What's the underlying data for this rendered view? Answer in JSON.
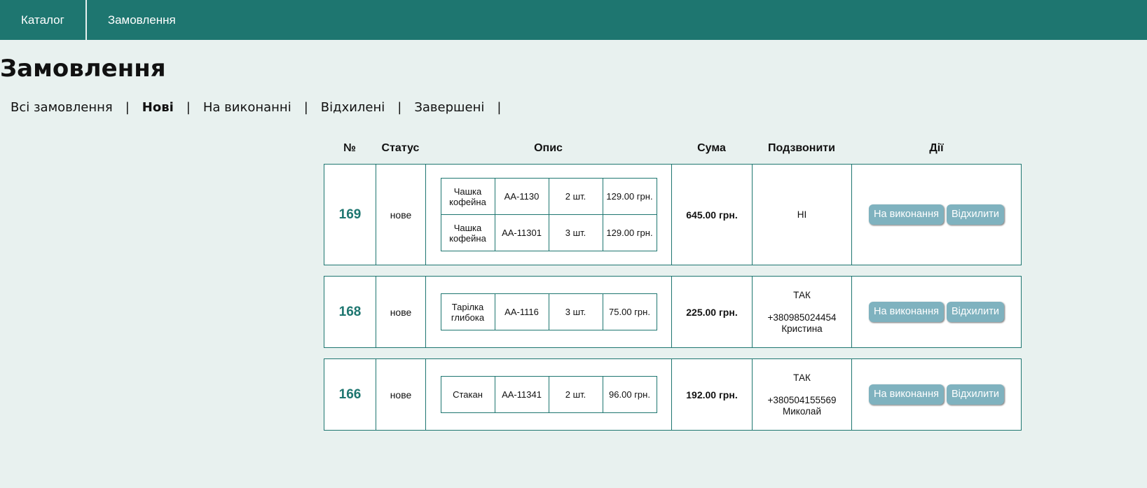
{
  "nav": {
    "items": [
      {
        "label": "Каталог"
      },
      {
        "label": "Замовлення"
      }
    ]
  },
  "page": {
    "title": "Замовлення"
  },
  "filters": [
    {
      "label": "Всі замовлення",
      "active": false
    },
    {
      "label": "Нові",
      "active": true
    },
    {
      "label": "На виконанні",
      "active": false
    },
    {
      "label": "Відхилені",
      "active": false
    },
    {
      "label": "Завершені",
      "active": false
    }
  ],
  "filter_separator": "|",
  "table": {
    "headers": {
      "no": "№",
      "status": "Статус",
      "desc": "Опис",
      "sum": "Сума",
      "call": "Подзвонити",
      "actions": "Дії"
    }
  },
  "orders": [
    {
      "id": "169",
      "status": "нове",
      "items": [
        {
          "name": "Чашка кофейна",
          "code": "АА-1130",
          "qty": "2 шт.",
          "price": "129.00 грн."
        },
        {
          "name": "Чашка кофейна",
          "code": "АА-11301",
          "qty": "3 шт.",
          "price": "129.00 грн."
        }
      ],
      "sum": "645.00 грн.",
      "call": {
        "answer": "НІ",
        "phone": "",
        "name": ""
      },
      "actions": {
        "accept": "На виконання",
        "reject": "Відхилити"
      }
    },
    {
      "id": "168",
      "status": "нове",
      "items": [
        {
          "name": "Тарілка глибока",
          "code": "АА-1116",
          "qty": "3 шт.",
          "price": "75.00 грн."
        }
      ],
      "sum": "225.00 грн.",
      "call": {
        "answer": "ТАК",
        "phone": "+380985024454",
        "name": "Кристина"
      },
      "actions": {
        "accept": "На виконання",
        "reject": "Відхилити"
      }
    },
    {
      "id": "166",
      "status": "нове",
      "items": [
        {
          "name": "Стакан",
          "code": "АА-11341",
          "qty": "2 шт.",
          "price": "96.00 грн."
        }
      ],
      "sum": "192.00 грн.",
      "call": {
        "answer": "ТАК",
        "phone": "+380504155569",
        "name": "Миколай"
      },
      "actions": {
        "accept": "На виконання",
        "reject": "Відхилити"
      }
    }
  ]
}
